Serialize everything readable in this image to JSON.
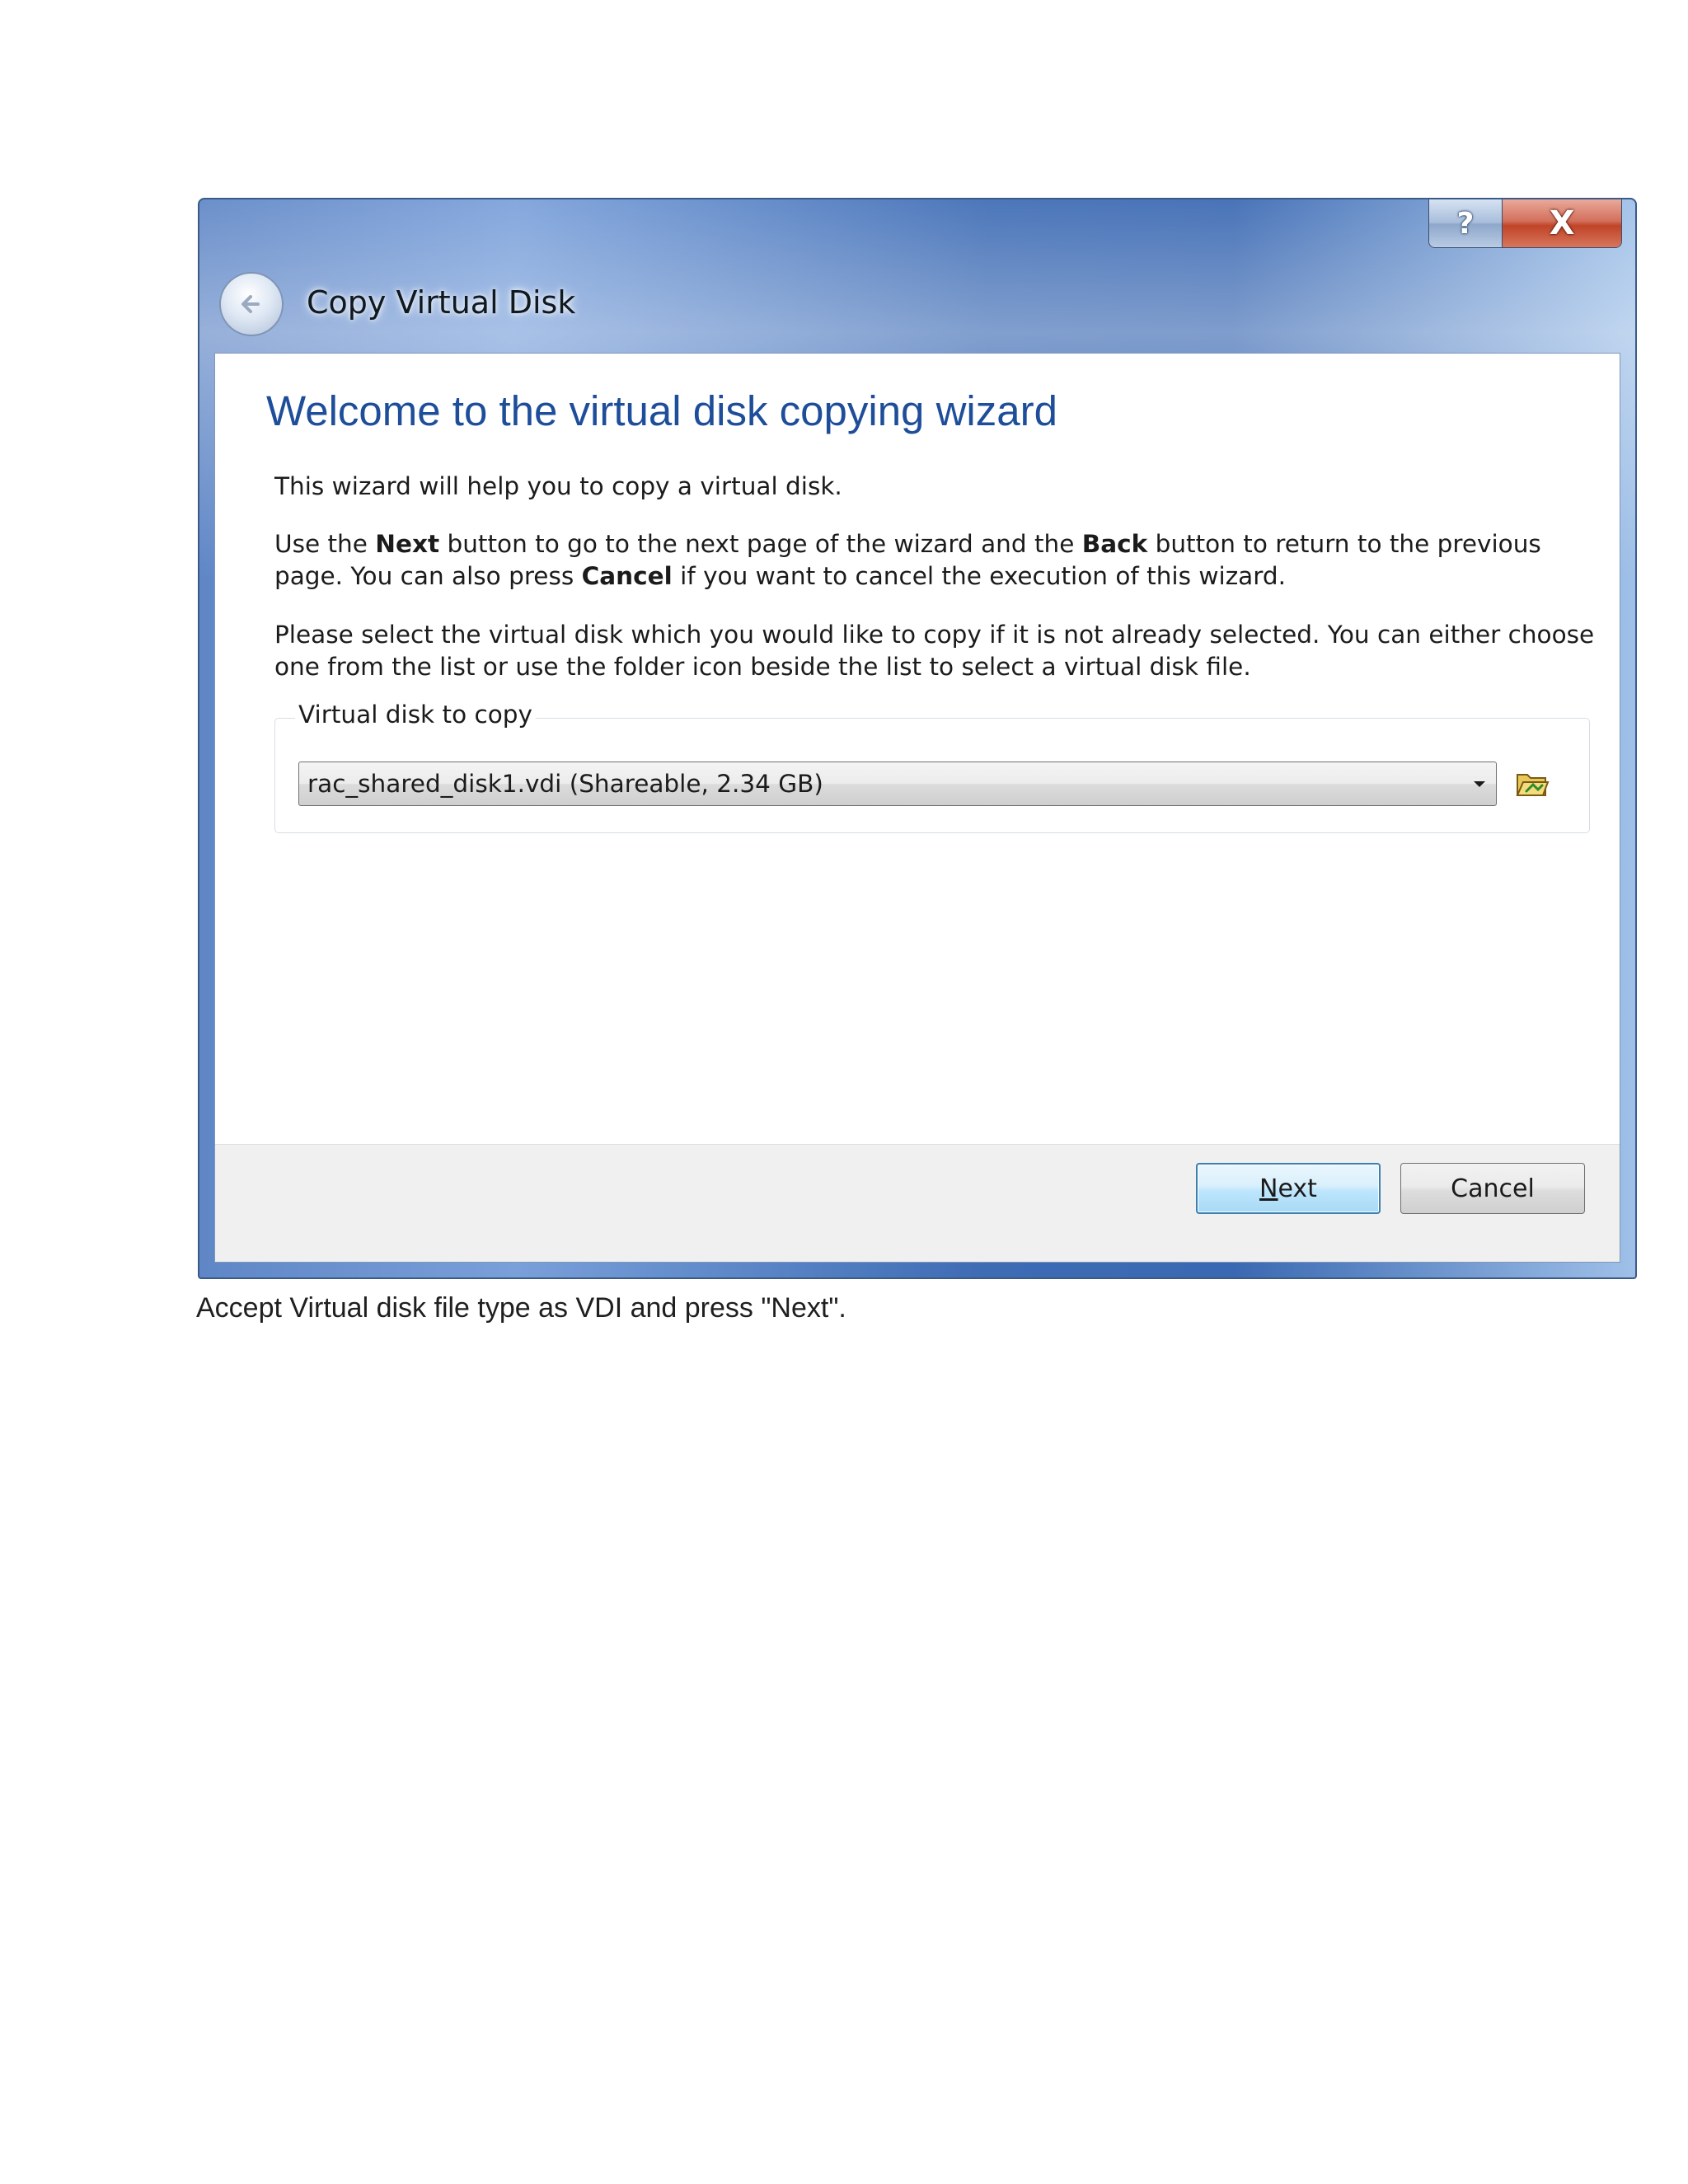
{
  "window": {
    "title": "Copy Virtual Disk",
    "help_glyph": "?",
    "close_glyph": "X"
  },
  "page": {
    "heading": "Welcome to the virtual disk copying wizard",
    "intro": "This wizard will help you to copy a virtual disk.",
    "nav_help": {
      "part1": "Use the ",
      "next_word": "Next",
      "part2": " button to go to the next page of the wizard and the ",
      "back_word": "Back",
      "part3": " button to return to the previous page. You can also press ",
      "cancel_word": "Cancel",
      "part4": " if you want to cancel the execution of this wizard."
    },
    "select_help": "Please select the virtual disk which you would like to copy if it is not already selected. You can either choose one from the list or use the folder icon beside the list to select a virtual disk file."
  },
  "disk_group": {
    "legend": "Virtual disk to copy",
    "selected_value": "rac_shared_disk1.vdi (Shareable, 2.34 GB)"
  },
  "buttons": {
    "next_mnemonic": "N",
    "next_rest": "ext",
    "cancel": "Cancel"
  },
  "document": {
    "caption": "Accept Virtual disk file type as VDI and press \"Next\"."
  },
  "icons": {
    "back": "back-arrow-icon",
    "dropdown": "chevron-down-icon",
    "folder": "folder-open-icon"
  },
  "colors": {
    "heading": "#1e4e9a",
    "titlebar": "#3d6bb4",
    "close_button": "#c04428",
    "next_button_border": "#3c7fb1"
  }
}
